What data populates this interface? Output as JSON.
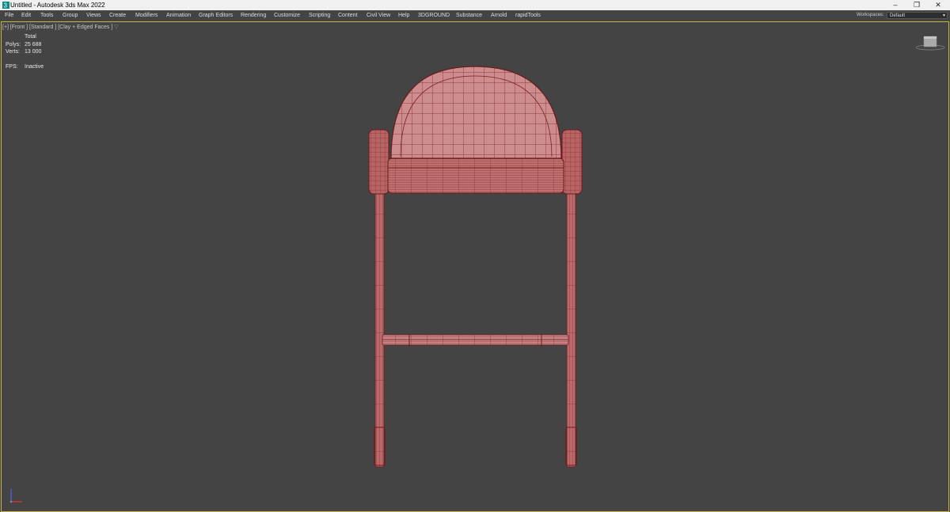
{
  "window": {
    "title": "Untitled - Autodesk 3ds Max 2022",
    "minimize": "–",
    "restore": "❐",
    "close": "✕"
  },
  "menu": [
    "File",
    "Edit",
    "Tools",
    "Group",
    "Views",
    "Create",
    "Modifiers",
    "Animation",
    "Graph Editors",
    "Rendering",
    "Customize",
    "Scripting",
    "Content",
    "Civil View",
    "Help",
    "3DGROUND",
    "Substance",
    "Arnold",
    "rapidTools"
  ],
  "workspaces": {
    "label": "Workspaces:",
    "value": "Default"
  },
  "viewport": {
    "label": "[+] [Front ] [Standard ] [Clay + Edged Faces ]",
    "stats": {
      "header": "Total",
      "polys_label": "Polys:",
      "polys": "25 688",
      "verts_label": "Verts:",
      "verts": "13 000",
      "fps_label": "FPS:",
      "fps": "Inactive"
    }
  },
  "colors": {
    "viewport_bg": "#444444",
    "model_fill": "#c9797a",
    "model_wire": "#7a1f1f",
    "active_border": "#c9b24a"
  }
}
